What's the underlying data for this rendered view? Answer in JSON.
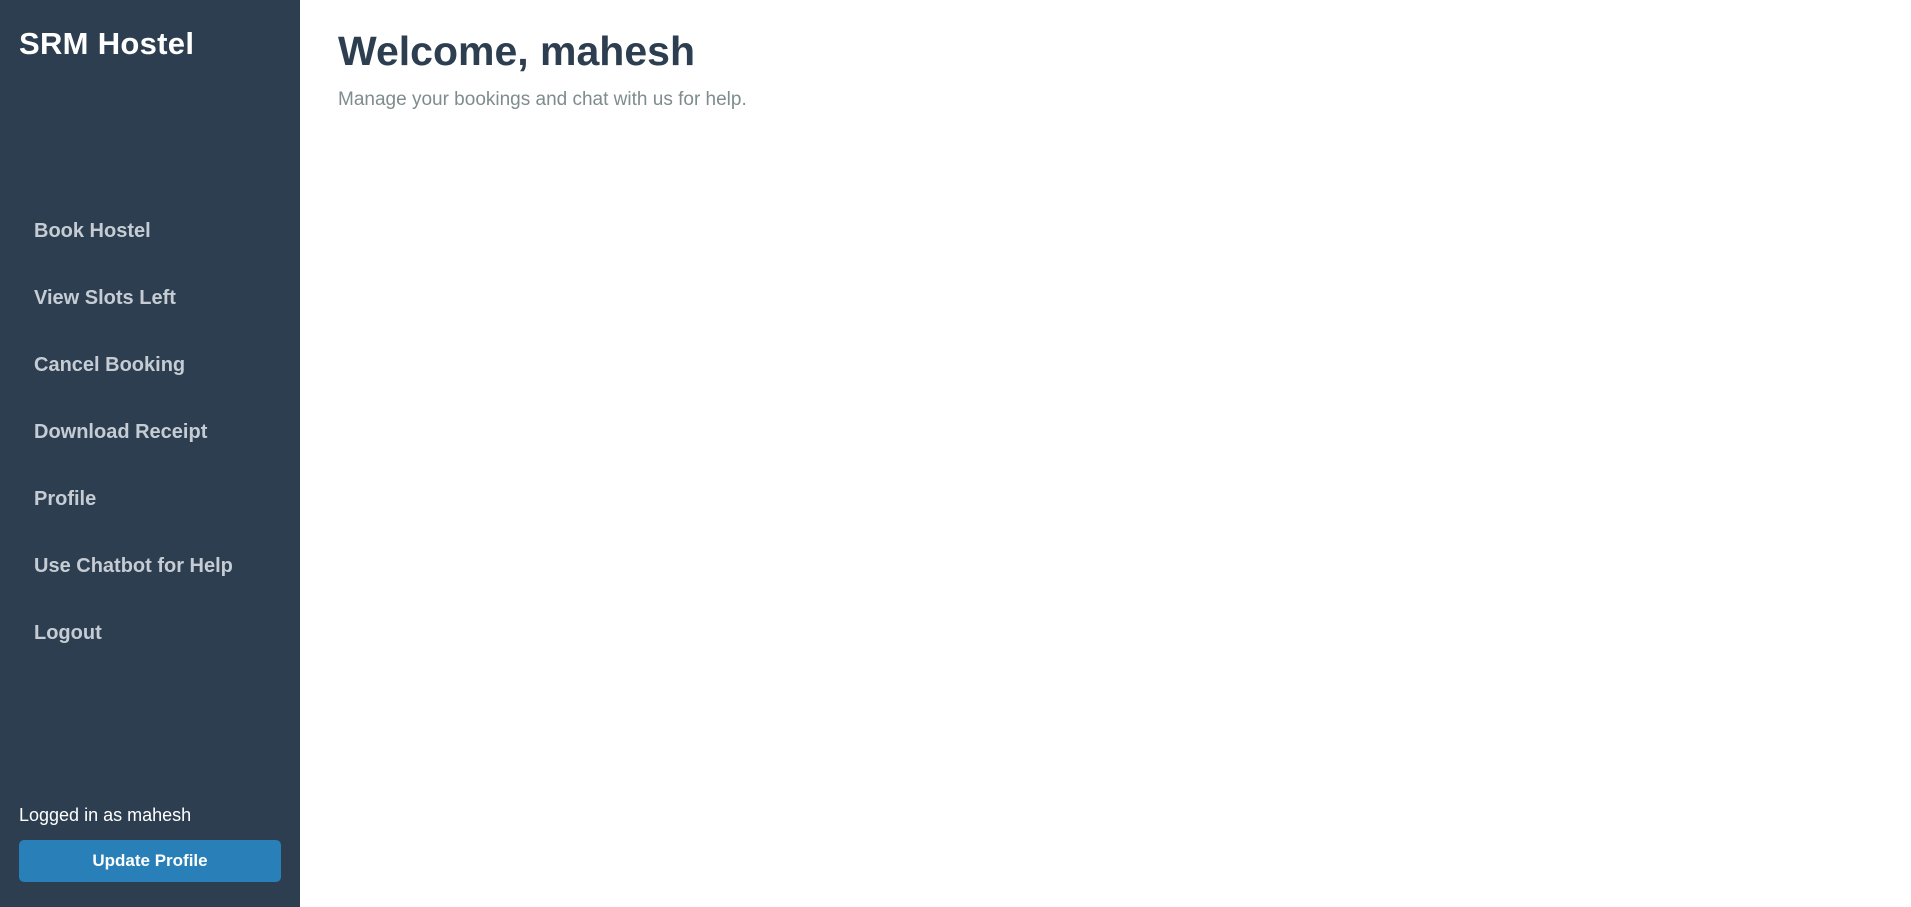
{
  "sidebar": {
    "brand": "SRM Hostel",
    "items": [
      {
        "label": "Book Hostel"
      },
      {
        "label": "View Slots Left"
      },
      {
        "label": "Cancel Booking"
      },
      {
        "label": "Download Receipt"
      },
      {
        "label": "Profile"
      },
      {
        "label": "Use Chatbot for Help"
      },
      {
        "label": "Logout"
      }
    ],
    "footer": {
      "logged_in_text": "Logged in as mahesh",
      "update_profile_label": "Update Profile"
    }
  },
  "main": {
    "title": "Welcome, mahesh",
    "subtitle": "Manage your bookings and chat with us for help."
  },
  "colors": {
    "sidebar_bg": "#2c3e50",
    "button_bg": "#2980b9",
    "title_color": "#2c3e50",
    "subtitle_color": "#7f8c8d"
  }
}
